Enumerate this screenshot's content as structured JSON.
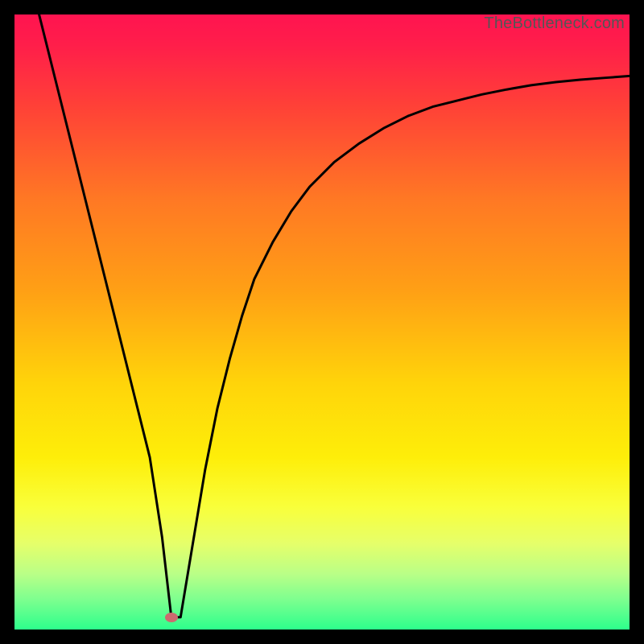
{
  "watermark": "TheBottleneck.com",
  "chart_data": {
    "type": "line",
    "title": "",
    "xlabel": "",
    "ylabel": "",
    "xlim": [
      0,
      100
    ],
    "ylim": [
      0,
      100
    ],
    "grid": false,
    "legend": false,
    "series": [
      {
        "name": "curve",
        "x": [
          4,
          6,
          8,
          10,
          12,
          14,
          16,
          18,
          20,
          22,
          24,
          25.5,
          27,
          29,
          31,
          33,
          35,
          37,
          39,
          42,
          45,
          48,
          52,
          56,
          60,
          64,
          68,
          72,
          76,
          80,
          84,
          88,
          92,
          96,
          100
        ],
        "y": [
          100,
          92,
          84,
          76,
          68,
          60,
          52,
          44,
          36,
          28,
          15,
          2,
          2,
          14,
          26,
          36,
          44,
          51,
          57,
          63,
          68,
          72,
          76,
          79,
          81.5,
          83.5,
          85,
          86,
          87,
          87.8,
          88.5,
          89,
          89.4,
          89.7,
          90
        ]
      }
    ],
    "marker": {
      "x": 25.5,
      "y": 2
    },
    "gradient_stops": [
      {
        "pct": 0,
        "color": "#ff1450"
      },
      {
        "pct": 5,
        "color": "#ff1e4a"
      },
      {
        "pct": 15,
        "color": "#ff4137"
      },
      {
        "pct": 30,
        "color": "#ff7824"
      },
      {
        "pct": 45,
        "color": "#ffa015"
      },
      {
        "pct": 60,
        "color": "#ffd40a"
      },
      {
        "pct": 72,
        "color": "#feee09"
      },
      {
        "pct": 80,
        "color": "#f9ff3a"
      },
      {
        "pct": 86,
        "color": "#e6ff6a"
      },
      {
        "pct": 91,
        "color": "#b9ff87"
      },
      {
        "pct": 95,
        "color": "#7fff8f"
      },
      {
        "pct": 100,
        "color": "#2dff8c"
      }
    ]
  }
}
